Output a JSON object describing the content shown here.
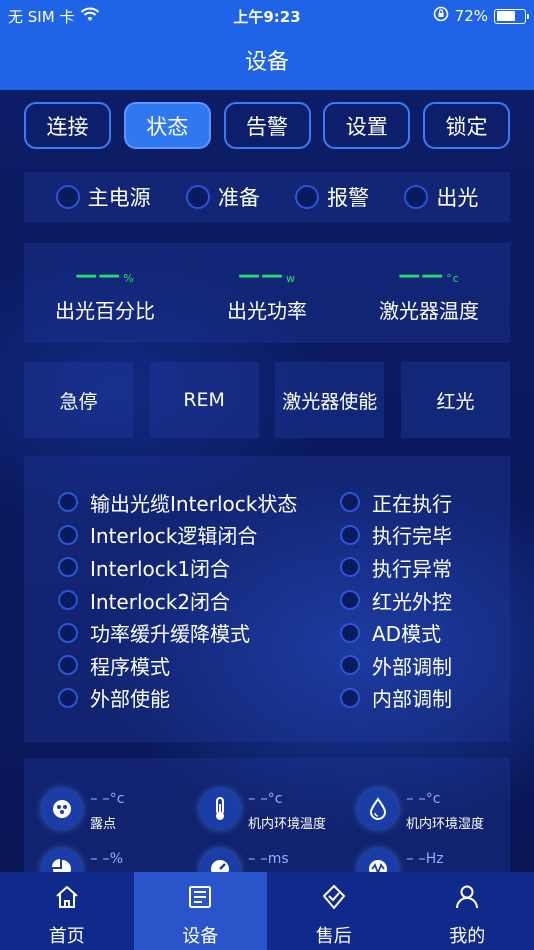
{
  "status_bar": {
    "carrier": "无 SIM 卡",
    "time": "上午9:23",
    "battery": "72%",
    "battery_level": 0.72
  },
  "nav": {
    "title": "设备"
  },
  "tabs": [
    {
      "label": "连接",
      "active": false
    },
    {
      "label": "状态",
      "active": true
    },
    {
      "label": "告警",
      "active": false
    },
    {
      "label": "设置",
      "active": false
    },
    {
      "label": "锁定",
      "active": false
    }
  ],
  "indicators": [
    {
      "label": "主电源"
    },
    {
      "label": "准备"
    },
    {
      "label": "报警"
    },
    {
      "label": "出光"
    }
  ],
  "readouts": [
    {
      "value": "——",
      "unit": "%",
      "label": "出光百分比"
    },
    {
      "value": "——",
      "unit": "w",
      "label": "出光功率"
    },
    {
      "value": "——",
      "unit": "°c",
      "label": "激光器温度"
    }
  ],
  "buttons": [
    {
      "label": "急停"
    },
    {
      "label": "REM"
    },
    {
      "label": "激光器使能"
    },
    {
      "label": "红光"
    }
  ],
  "status_left": [
    "输出光缆Interlock状态",
    "Interlock逻辑闭合",
    "Interlock1闭合",
    "Interlock2闭合",
    "功率缓升缓降模式",
    "程序模式",
    "外部使能"
  ],
  "status_right": [
    "正在执行",
    "执行完毕",
    "执行异常",
    "红光外控",
    "AD模式",
    "外部调制",
    "内部调制"
  ],
  "sensors": [
    {
      "value": "– –",
      "unit": "°c",
      "label": "露点",
      "icon": "dew-point-icon"
    },
    {
      "value": "– –",
      "unit": "°c",
      "label": "机内环境温度",
      "icon": "thermometer-icon"
    },
    {
      "value": "– –",
      "unit": "°c",
      "label": "机内环境湿度",
      "icon": "humidity-icon"
    },
    {
      "value": "– –",
      "unit": "%",
      "label": "",
      "icon": "pie-icon"
    },
    {
      "value": "– –",
      "unit": "ms",
      "label": "",
      "icon": "gauge-icon"
    },
    {
      "value": "– –",
      "unit": "Hz",
      "label": "",
      "icon": "frequency-icon"
    }
  ],
  "tabbar": [
    {
      "label": "首页",
      "icon": "home-icon",
      "active": false
    },
    {
      "label": "设备",
      "icon": "device-list-icon",
      "active": true
    },
    {
      "label": "售后",
      "icon": "after-sales-icon",
      "active": false
    },
    {
      "label": "我的",
      "icon": "user-icon",
      "active": false
    }
  ]
}
